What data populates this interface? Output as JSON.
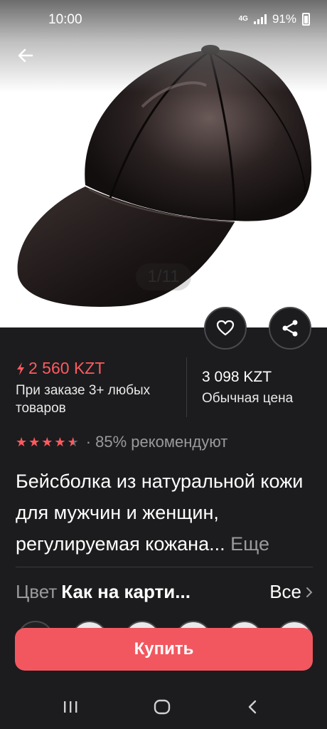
{
  "status_bar": {
    "time": "10:00",
    "network": "4G",
    "battery": "91%"
  },
  "image": {
    "counter": "1/11"
  },
  "price": {
    "promo_price": "2 560 KZT",
    "promo_note": "При заказе 3+ любых товаров",
    "regular_price": "3 098 KZT",
    "regular_label": "Обычная цена"
  },
  "rating": {
    "stars": 4.5,
    "recommend_text": "· 85% рекомендуют"
  },
  "product": {
    "title": "Бейсболка из натуральной кожи для мужчин и женщин, регулируемая кожана...",
    "more_label": "Еще"
  },
  "color": {
    "label": "Цвет",
    "value": "Как на карти...",
    "all_label": "Все"
  },
  "buy_button": {
    "label": "Купить"
  },
  "colors": {
    "accent": "#f2575f",
    "background": "#1c1c1e",
    "text_muted": "#9a9a9e"
  },
  "icons": [
    "back-arrow-icon",
    "heart-icon",
    "share-icon",
    "bolt-icon",
    "chevron-right-icon",
    "recents-icon",
    "home-icon",
    "back-icon"
  ]
}
